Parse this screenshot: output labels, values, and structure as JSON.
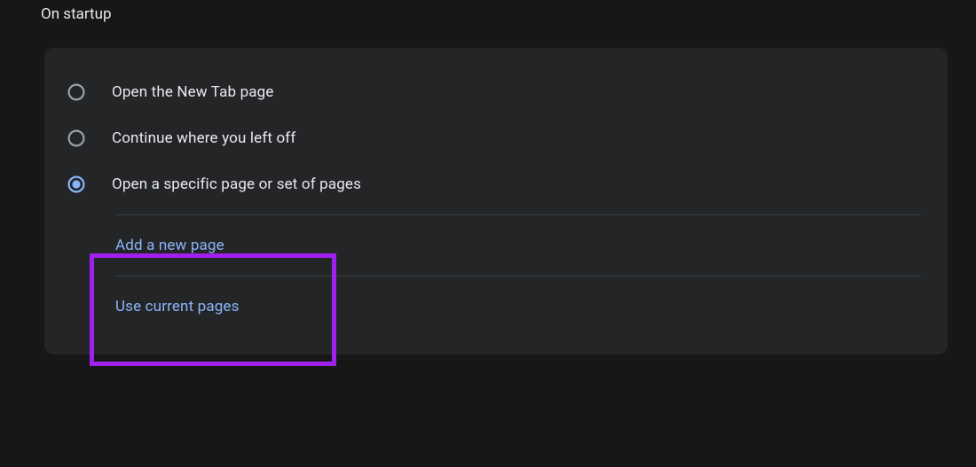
{
  "section_title": "On startup",
  "options": {
    "new_tab": {
      "label": "Open the New Tab page"
    },
    "continue": {
      "label": "Continue where you left off"
    },
    "specific": {
      "label": "Open a specific page or set of pages"
    }
  },
  "links": {
    "add_new_page": "Add a new page",
    "use_current_pages": "Use current pages"
  },
  "colors": {
    "accent": "#8ab4f8",
    "radio_unselected": "#9aa0a6",
    "highlight": "#a020f0"
  }
}
